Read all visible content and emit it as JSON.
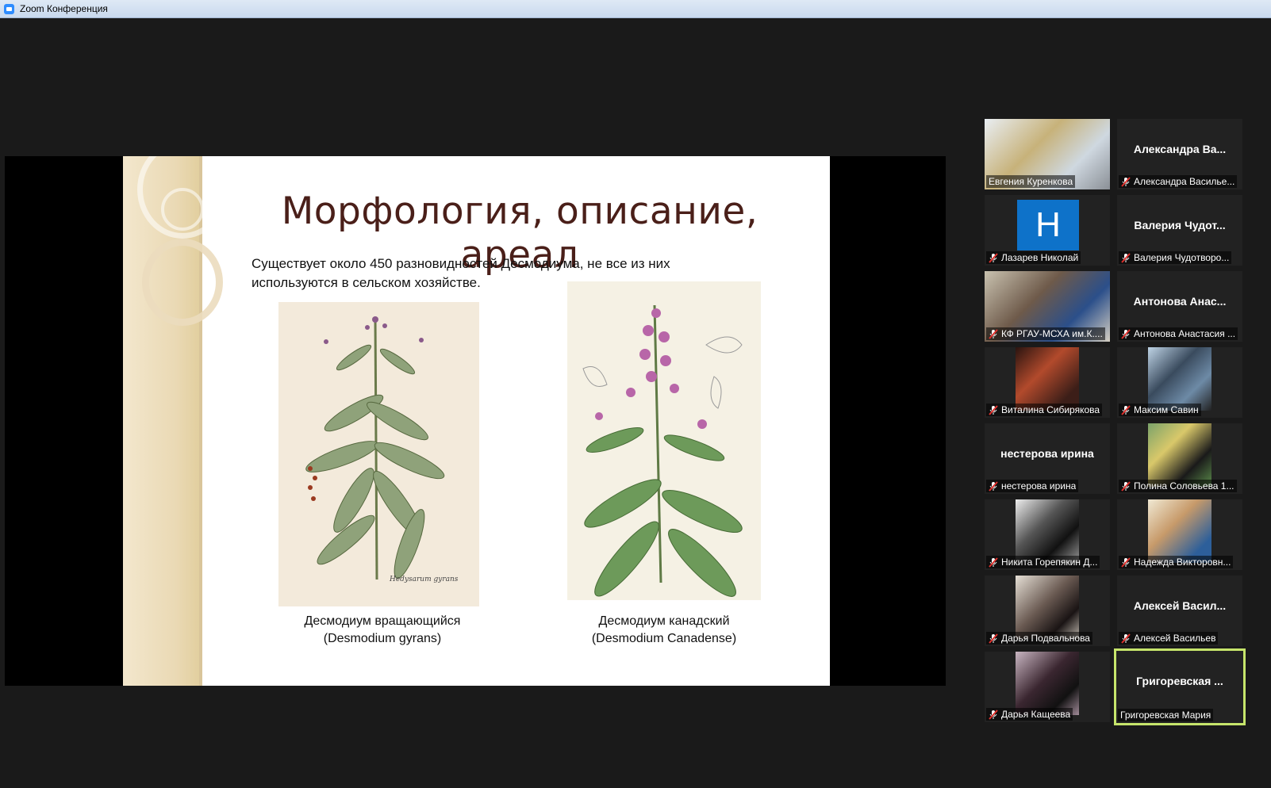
{
  "window": {
    "title": "Zoom Конференция"
  },
  "slide": {
    "title": "Морфология, описание, ареал",
    "body": "Существует около 450 разновидностей Десмодиума, не все из них используются в сельском хозяйстве.",
    "left_caption_1": "Десмодиум вращающийся",
    "left_caption_2": "(Desmodium gyrans)",
    "right_caption_1": "Десмодиум канадский",
    "right_caption_2": "(Desmodium Canadense)"
  },
  "participants": [
    {
      "name": "Евгения Куренкова",
      "big": "",
      "muted": false,
      "video": true
    },
    {
      "name": "Александра Василье...",
      "big": "Александра  Ва...",
      "muted": true,
      "video": false
    },
    {
      "name": "Лазарев Николай",
      "big": "",
      "avatar": "Н",
      "muted": true,
      "video": false
    },
    {
      "name": "Валерия Чудотворо...",
      "big": "Валерия  Чудот...",
      "muted": true,
      "video": false
    },
    {
      "name": "КФ РГАУ-МСХА им.К....",
      "big": "",
      "muted": true,
      "video": true
    },
    {
      "name": "Антонова Анастасия ...",
      "big": "Антонова  Анас...",
      "muted": true,
      "video": false
    },
    {
      "name": "Виталина Сибирякова",
      "big": "",
      "muted": true,
      "video": true
    },
    {
      "name": "Максим Савин",
      "big": "",
      "muted": true,
      "video": true
    },
    {
      "name": "нестерова ирина",
      "big": "нестерова ирина",
      "muted": true,
      "video": false
    },
    {
      "name": "Полина Соловьева 1...",
      "big": "",
      "muted": true,
      "video": true
    },
    {
      "name": "Никита Горепякин Д...",
      "big": "",
      "muted": true,
      "video": true
    },
    {
      "name": "Надежда Викторовн...",
      "big": "",
      "muted": true,
      "video": true
    },
    {
      "name": "Дарья Подвальнова",
      "big": "",
      "muted": true,
      "video": true
    },
    {
      "name": "Алексей Васильев",
      "big": "Алексей  Васил...",
      "muted": true,
      "video": false
    },
    {
      "name": "Дарья Кащеева",
      "big": "",
      "muted": true,
      "video": true
    },
    {
      "name": "Григоревская Мария",
      "big": "Григоревская ...",
      "muted": false,
      "video": false,
      "active": true
    }
  ]
}
